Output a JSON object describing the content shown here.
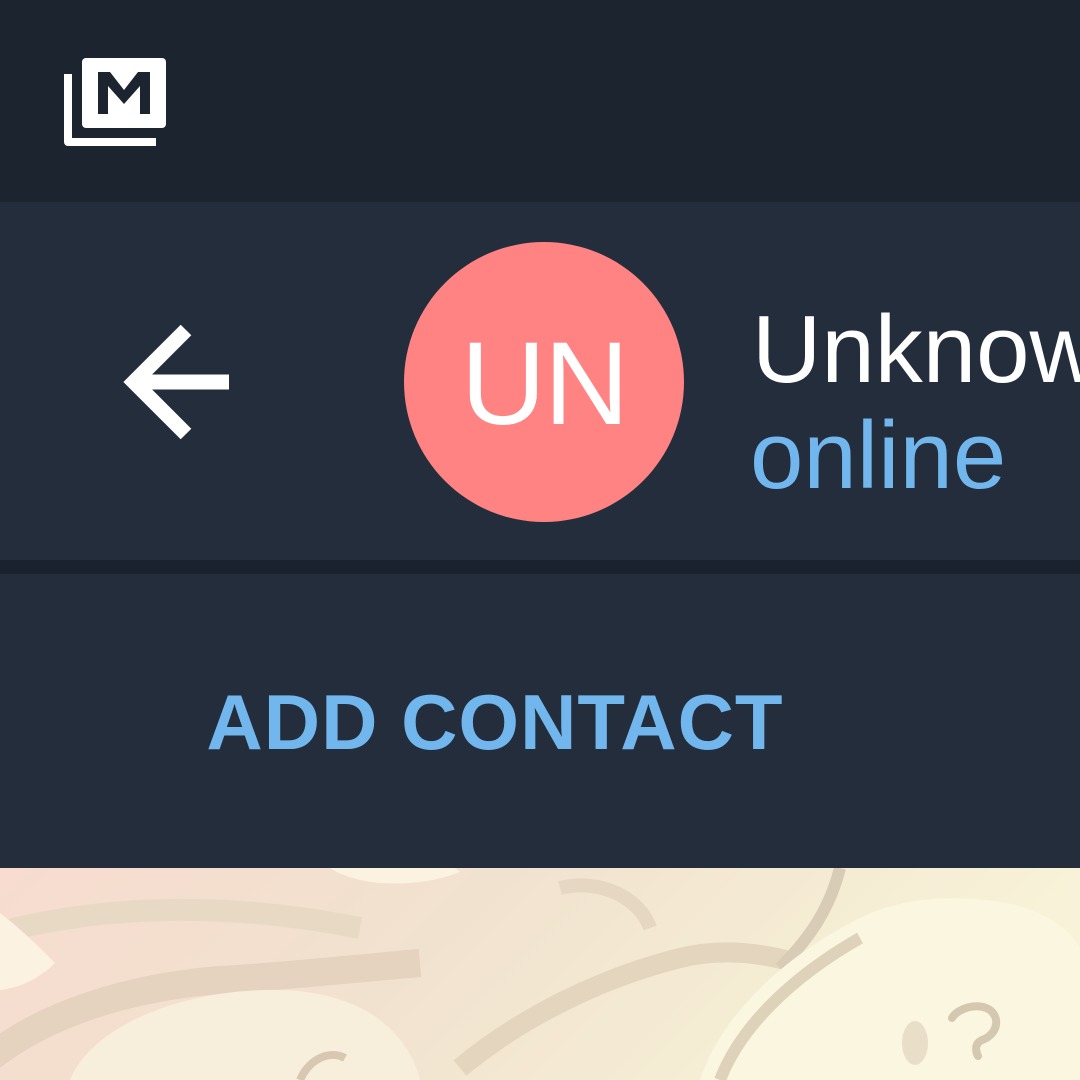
{
  "app": {
    "logo_icon": "app-logo-icon"
  },
  "header": {
    "back_icon": "arrow-left-icon",
    "avatar": {
      "initials": "UN",
      "color": "#ff8383"
    },
    "contact_name": "Unknow",
    "status": "online"
  },
  "actions": {
    "add_contact_label": "ADD CONTACT"
  },
  "colors": {
    "status_bar": "#1c2430",
    "header_bg": "#232d3c",
    "accent": "#71b6ec",
    "text_primary": "#ffffff",
    "chat_wallpaper": "#f3e7d2"
  }
}
